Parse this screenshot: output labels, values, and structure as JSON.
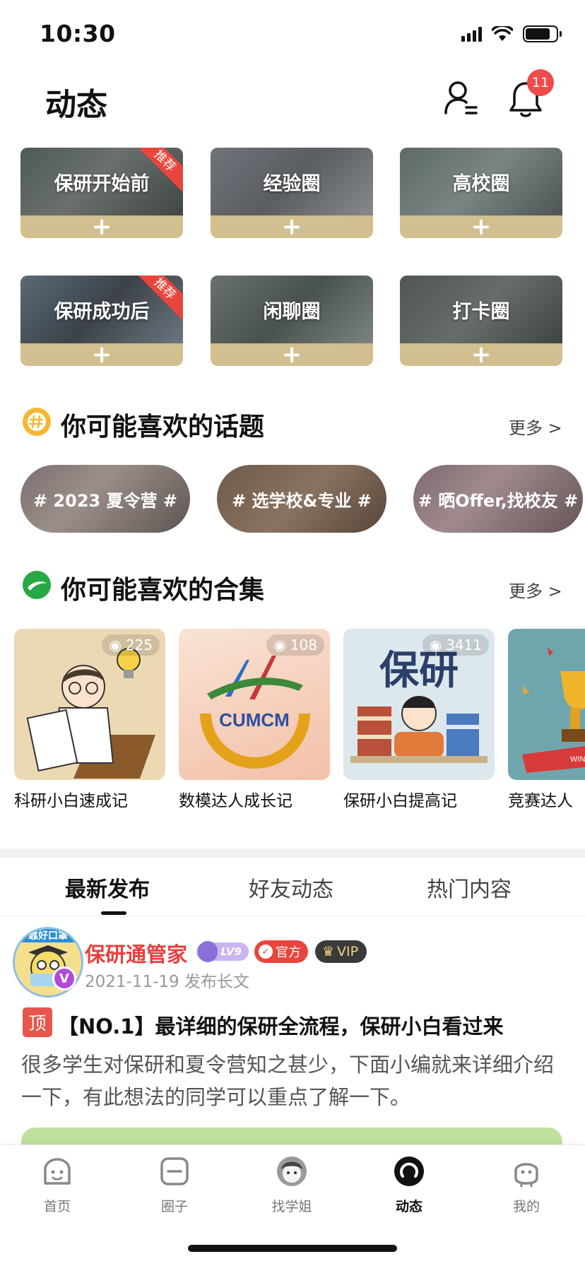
{
  "status_bar": {
    "time": "10:30"
  },
  "header": {
    "title": "动态",
    "notification_count": "11"
  },
  "circles": [
    {
      "name": "保研开始前",
      "ribbon": "推荐"
    },
    {
      "name": "经验圈",
      "ribbon": ""
    },
    {
      "name": "高校圈",
      "ribbon": ""
    },
    {
      "name": "保研成功后",
      "ribbon": "推荐"
    },
    {
      "name": "闲聊圈",
      "ribbon": ""
    },
    {
      "name": "打卡圈",
      "ribbon": ""
    }
  ],
  "circle_join_symbol": "+",
  "topics_section": {
    "title": "你可能喜欢的话题",
    "more": "更多 >",
    "topics": [
      "# 2023 夏令营 #",
      "# 选学校&专业 #",
      "# 晒Offer,找校友 #"
    ]
  },
  "collections_section": {
    "title": "你可能喜欢的合集",
    "more": "更多 >",
    "items": [
      {
        "title": "科研小白速成记",
        "views": "225"
      },
      {
        "title": "数模达人成长记",
        "views": "108",
        "art_text": "CUMCM"
      },
      {
        "title": "保研小白提高记",
        "views": "3411",
        "art_text": "保研"
      },
      {
        "title": "竞赛达人",
        "views": "",
        "art_text": "WIN"
      }
    ]
  },
  "feed_tabs": [
    "最新发布",
    "好友动态",
    "热门内容"
  ],
  "post": {
    "avatar_text": "靠好口罩",
    "verified_mark": "V",
    "author": "保研通管家",
    "level": "LV9",
    "official": "官方",
    "vip": "VIP",
    "meta": "2021-11-19  发布长文",
    "pin": "顶",
    "title": "【NO.1】最详细的保研全流程，保研小白看过来",
    "excerpt": "很多学生对保研和夏令营知之甚少，下面小编就来详细介绍一下，有此想法的同学可以重点了解一下。"
  },
  "bottom_nav": [
    {
      "label": "首页",
      "icon": "home-icon"
    },
    {
      "label": "圈子",
      "icon": "circle-icon"
    },
    {
      "label": "找学姐",
      "icon": "senior-avatar-icon"
    },
    {
      "label": "动态",
      "icon": "feed-icon",
      "active": true
    },
    {
      "label": "我的",
      "icon": "profile-icon"
    }
  ],
  "colors": {
    "accent_gold": "#d2bf90",
    "ribbon_red": "#e8453c",
    "author_red": "#e83d3d",
    "topic_icon": "#f5b731",
    "collection_icon": "#27a844"
  }
}
